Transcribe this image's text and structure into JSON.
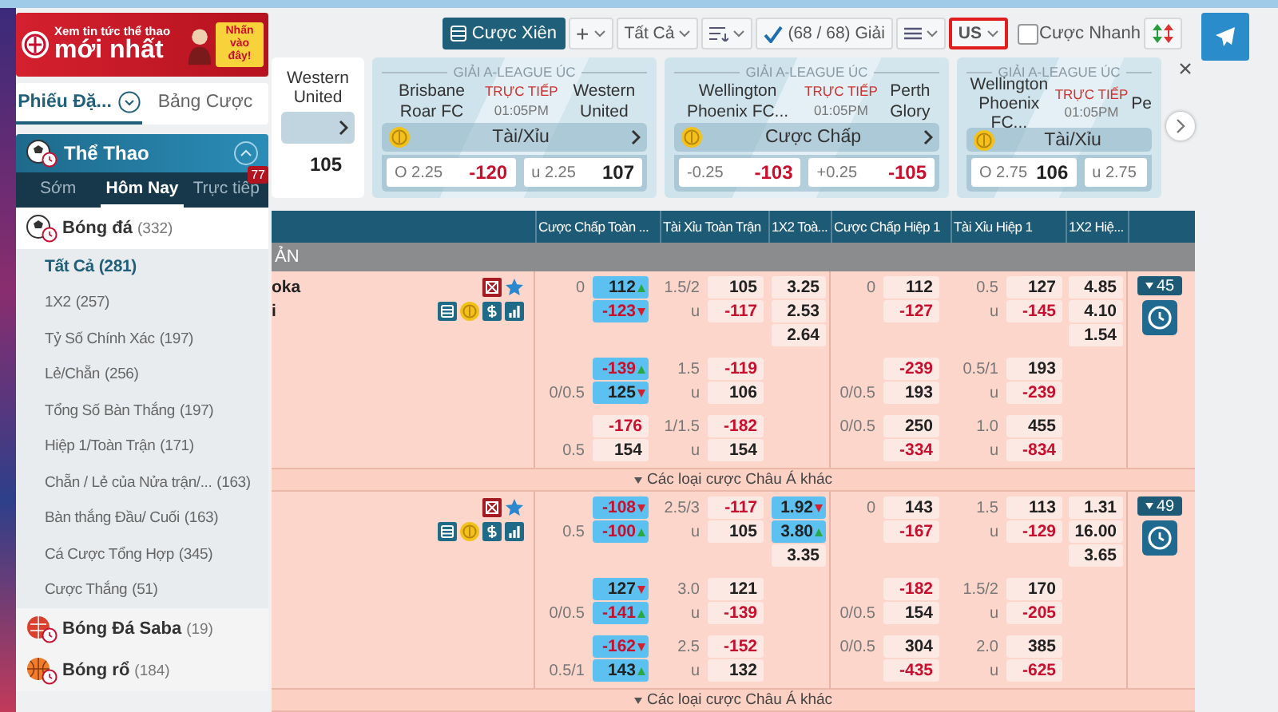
{
  "sidebar": {
    "banner": {
      "title": "Xem tin tức thể thao",
      "headline": "mới nhất",
      "callout": "Nhấn vào đây!"
    },
    "tabs": [
      {
        "label": "Phiếu Đặ...",
        "selected": true
      },
      {
        "label": "Bảng Cược",
        "selected": false
      }
    ],
    "section": {
      "title": "Thể Thao",
      "expanded": true
    },
    "periods": [
      {
        "label": "Sớm",
        "selected": false
      },
      {
        "label": "Hôm Nay",
        "selected": true
      },
      {
        "label": "Trực tiếp",
        "selected": false,
        "badge": "77"
      }
    ],
    "sports": [
      {
        "name": "Bóng đá",
        "count": "(332)",
        "kind": "football",
        "markets": [
          {
            "label": "Tất Cả",
            "count": "(281)",
            "selected": true
          },
          {
            "label": "1X2",
            "count": "(257)",
            "selected": false
          },
          {
            "label": "Tỷ Số Chính Xác",
            "count": "(197)",
            "selected": false
          },
          {
            "label": "Lẻ/Chẵn",
            "count": "(256)",
            "selected": false
          },
          {
            "label": "Tổng Số Bàn Thắng",
            "count": "(197)",
            "selected": false
          },
          {
            "label": "Hiệp 1/Toàn Trận",
            "count": "(171)",
            "selected": false
          },
          {
            "label": "Chẵn / Lẻ của Nửa trận/...",
            "count": "(163)",
            "selected": false
          },
          {
            "label": "Bàn thắng Đầu/ Cuối",
            "count": "(163)",
            "selected": false
          },
          {
            "label": "Cá Cược Tổng Hợp",
            "count": "(345)",
            "selected": false
          },
          {
            "label": "Cược Thắng",
            "count": "(51)",
            "selected": false
          }
        ]
      },
      {
        "name": "Bóng Đá Saba",
        "count": "(19)",
        "kind": "saba"
      },
      {
        "name": "Bóng rổ",
        "count": "(184)",
        "kind": "basketball"
      }
    ]
  },
  "toolbar": {
    "parlay_button": "Cược Xiên",
    "add_menu": "+",
    "filter": "Tất Cả",
    "leagues": "(68 / 68) Giải",
    "odds_format": {
      "label": "US",
      "highlighted": true
    },
    "quick_bet": {
      "label": "Cược Nhanh",
      "checked": false
    }
  },
  "cards": [
    {
      "away": "Western United",
      "has_more": true,
      "selections": [
        {
          "odds": "105"
        }
      ]
    },
    {
      "league": "GIẢI A-LEAGUE ÚC",
      "home": "Brisbane Roar FC",
      "status": "TRỰC TIẾP",
      "time": "01:05PM",
      "away": "Western United",
      "market": "Tài/Xỉu",
      "has_more": true,
      "selections": [
        {
          "label": "O 2.25",
          "odds": "-120"
        },
        {
          "label": "u 2.25",
          "odds": "107"
        }
      ]
    },
    {
      "league": "GIẢI A-LEAGUE ÚC",
      "home": "Wellington Phoenix FC...",
      "status": "TRỰC TIẾP",
      "time": "01:05PM",
      "away": "Perth Glory",
      "market": "Cược Chấp",
      "has_more": true,
      "selections": [
        {
          "label": "-0.25",
          "odds": "-103"
        },
        {
          "label": "+0.25",
          "odds": "-105"
        }
      ]
    },
    {
      "league": "GIẢI A-LEAGUE ÚC",
      "home": "Wellington Phoenix FC...",
      "status": "TRỰC TIẾP",
      "time": "01:05PM",
      "away": "Pe",
      "market": "Tài/Xỉu",
      "has_more": false,
      "selections": [
        {
          "label": "O 2.75",
          "odds": "106"
        },
        {
          "label": "u 2.75"
        }
      ]
    }
  ],
  "table": {
    "columns": [
      "Cược Chấp Toàn ...",
      "Tài Xỉu Toàn Trận",
      "1X2 Toà...",
      "Cược Chấp Hiệp 1",
      "Tài Xỉu Hiệp 1",
      "1X2 Hiệ..."
    ],
    "league": "ẢN",
    "matches": [
      {
        "home": "oka",
        "away": "i",
        "count": "45",
        "more": "Các loại cược Châu Á khác",
        "lines": [
          {
            "ah": [
              {
                "line": "0",
                "odds": "112",
                "rising": true
              },
              {
                "odds": "-123",
                "rising": false
              }
            ],
            "ou": [
              {
                "line": "1.5/2",
                "odds": "105"
              },
              {
                "line": "u",
                "odds": "-117"
              }
            ],
            "x12": [
              {
                "odds": "3.25"
              },
              {
                "odds": "2.53"
              },
              {
                "odds": "2.64"
              }
            ],
            "ah1": [
              {
                "line": "0",
                "odds": "112"
              },
              {
                "odds": "-127"
              }
            ],
            "ou1": [
              {
                "line": "0.5",
                "odds": "127"
              },
              {
                "line": "u",
                "odds": "-145"
              }
            ],
            "x121": [
              {
                "odds": "4.85"
              },
              {
                "odds": "4.10"
              },
              {
                "odds": "1.54"
              }
            ]
          },
          {
            "ah": [
              {
                "odds": "-139",
                "rising": true
              },
              {
                "line": "0/0.5",
                "odds": "125",
                "rising": false
              }
            ],
            "ou": [
              {
                "line": "1.5",
                "odds": "-119"
              },
              {
                "line": "u",
                "odds": "106"
              }
            ],
            "ah1": [
              {
                "odds": "-239"
              },
              {
                "line": "0/0.5",
                "odds": "193"
              }
            ],
            "ou1": [
              {
                "line": "0.5/1",
                "odds": "193"
              },
              {
                "line": "u",
                "odds": "-239"
              }
            ]
          },
          {
            "ah": [
              {
                "odds": "-176"
              },
              {
                "line": "0.5",
                "odds": "154"
              }
            ],
            "ou": [
              {
                "line": "1/1.5",
                "odds": "-182"
              },
              {
                "line": "u",
                "odds": "154"
              }
            ],
            "ah1": [
              {
                "line": "0/0.5",
                "odds": "250"
              },
              {
                "odds": "-334"
              }
            ],
            "ou1": [
              {
                "line": "1.0",
                "odds": "455"
              },
              {
                "line": "u",
                "odds": "-834"
              }
            ]
          }
        ]
      },
      {
        "count": "49",
        "more": "Các loại cược Châu Á khác",
        "lines": [
          {
            "ah": [
              {
                "odds": "-108",
                "rising": false
              },
              {
                "line": "0.5",
                "odds": "-100",
                "rising": true
              }
            ],
            "ou": [
              {
                "line": "2.5/3",
                "odds": "-117"
              },
              {
                "line": "u",
                "odds": "105"
              }
            ],
            "x12": [
              {
                "odds": "1.92",
                "rising": false
              },
              {
                "odds": "3.80",
                "rising": true
              },
              {
                "odds": "3.35"
              }
            ],
            "ah1": [
              {
                "line": "0",
                "odds": "143"
              },
              {
                "odds": "-167"
              }
            ],
            "ou1": [
              {
                "line": "1.5",
                "odds": "113"
              },
              {
                "line": "u",
                "odds": "-129"
              }
            ],
            "x121": [
              {
                "odds": "1.31"
              },
              {
                "odds": "16.00"
              },
              {
                "odds": "3.65"
              }
            ]
          },
          {
            "ah": [
              {
                "odds": "127",
                "rising": false
              },
              {
                "line": "0/0.5",
                "odds": "-141",
                "rising": true
              }
            ],
            "ou": [
              {
                "line": "3.0",
                "odds": "121"
              },
              {
                "line": "u",
                "odds": "-139"
              }
            ],
            "ah1": [
              {
                "odds": "-182"
              },
              {
                "line": "0/0.5",
                "odds": "154"
              }
            ],
            "ou1": [
              {
                "line": "1.5/2",
                "odds": "170"
              },
              {
                "line": "u",
                "odds": "-205"
              }
            ]
          },
          {
            "ah": [
              {
                "odds": "-162",
                "rising": false
              },
              {
                "line": "0.5/1",
                "odds": "143",
                "rising": true
              }
            ],
            "ou": [
              {
                "line": "2.5",
                "odds": "-152"
              },
              {
                "line": "u",
                "odds": "132"
              }
            ],
            "ah1": [
              {
                "line": "0/0.5",
                "odds": "304"
              },
              {
                "odds": "-435"
              }
            ],
            "ou1": [
              {
                "line": "2.0",
                "odds": "385"
              },
              {
                "line": "u",
                "odds": "-625"
              }
            ]
          }
        ]
      }
    ]
  }
}
